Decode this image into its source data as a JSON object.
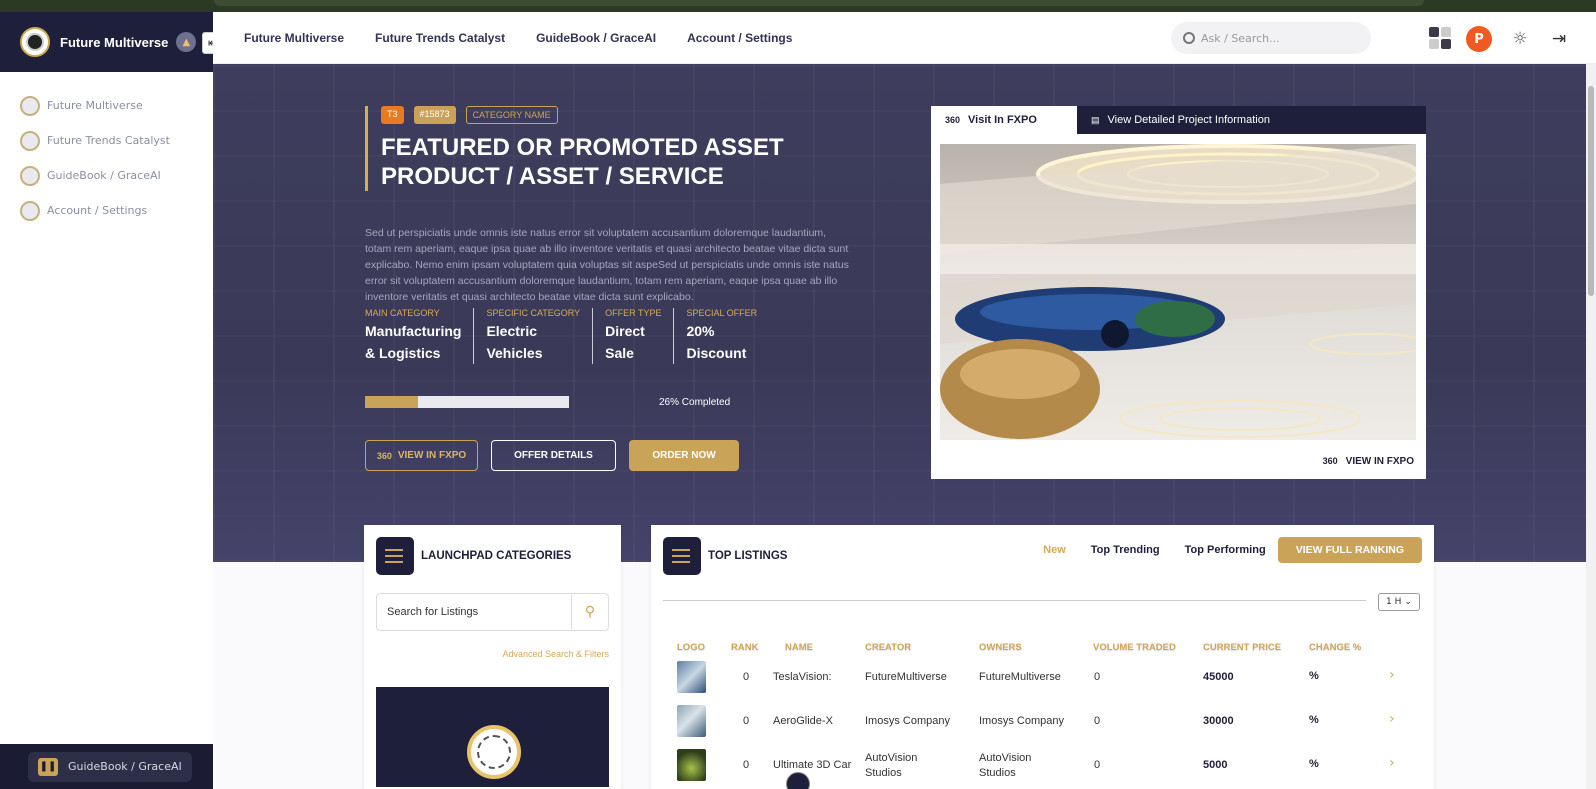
{
  "brand": {
    "title": "Future Multiverse"
  },
  "nav": {
    "links": [
      "Future Multiverse",
      "Future Trends Catalyst",
      "GuideBook / GraceAI",
      "Account / Settings"
    ],
    "search_placeholder": "Ask / Search...",
    "avatar_letter": "P"
  },
  "sidebar": {
    "items": [
      {
        "label": "Future Multiverse"
      },
      {
        "label": "Future Trends Catalyst"
      },
      {
        "label": "GuideBook / GraceAI"
      },
      {
        "label": "Account / Settings"
      }
    ],
    "footer_label": "GuideBook / GraceAI"
  },
  "hero": {
    "tags": {
      "tier": "T3",
      "id": "#15873",
      "category": "CATEGORY NAME"
    },
    "title_line1": "FEATURED OR PROMOTED ASSET",
    "title_line2": "PRODUCT / ASSET / SERVICE",
    "description": "Sed ut perspiciatis unde omnis iste natus error sit voluptatem accusantium doloremque laudantium, totam rem aperiam, eaque ipsa quae ab illo inventore veritatis et quasi architecto beatae vitae dicta sunt explicabo. Nemo enim ipsam voluptatem quia voluptas sit aspeSed ut perspiciatis unde omnis iste natus error sit voluptatem accusantium doloremque laudantium, totam rem aperiam, eaque ipsa quae ab illo inventore veritatis et quasi architecto beatae vitae dicta sunt explicabo.",
    "specs": [
      {
        "label": "MAIN CATEGORY",
        "value1": "Manufacturing",
        "value2": "& Logistics"
      },
      {
        "label": "SPECIFIC CATEGORY",
        "value1": "Electric",
        "value2": "Vehicles"
      },
      {
        "label": "OFFER TYPE",
        "value1": "Direct",
        "value2": "Sale"
      },
      {
        "label": "SPECIAL OFFER",
        "value1": "20%",
        "value2": "Discount"
      }
    ],
    "progress_percent": 26,
    "progress_label": "26% Completed",
    "buttons": {
      "view": "VIEW IN FXPO",
      "offer": "OFFER DETAILS",
      "order": "ORDER NOW"
    },
    "icon_360": "360"
  },
  "viewer": {
    "tab_visit": "Visit In FXPO",
    "tab_details": "View Detailed Project Information",
    "footer": "VIEW IN FXPO"
  },
  "categories": {
    "title": "LAUNCHPAD CATEGORIES",
    "search_placeholder": "Search for Listings",
    "advanced": "Advanced Search & Filters"
  },
  "listings": {
    "title": "TOP LISTINGS",
    "tabs": {
      "new": "New",
      "trending": "Top Trending",
      "performing": "Top Performing"
    },
    "ranking_button": "VIEW FULL RANKING",
    "period": "1 H",
    "columns": [
      "LOGO",
      "RANK",
      "NAME",
      "CREATOR",
      "OWNERS",
      "VOLUME TRADED",
      "CURRENT PRICE",
      "CHANGE %"
    ],
    "rows": [
      {
        "rank": "0",
        "name": "TeslaVision:",
        "creator1": "FutureMultiverse",
        "creator2": "",
        "owners1": "FutureMultiverse",
        "owners2": "",
        "volume": "0",
        "price": "45000",
        "change": "%"
      },
      {
        "rank": "0",
        "name": "AeroGlide-X",
        "creator1": "Imosys Company",
        "creator2": "",
        "owners1": "Imosys Company",
        "owners2": "",
        "volume": "0",
        "price": "30000",
        "change": "%"
      },
      {
        "rank": "0",
        "name": "Ultimate 3D Car",
        "creator1": "AutoVision",
        "creator2": "Studios",
        "owners1": "AutoVision",
        "owners2": "Studios",
        "volume": "0",
        "price": "5000",
        "change": "%"
      }
    ]
  },
  "colors": {
    "accent": "#c9a458",
    "navy": "#1e1f3a",
    "hero_bg": "#3b3a59",
    "avatar": "#f05a20"
  }
}
